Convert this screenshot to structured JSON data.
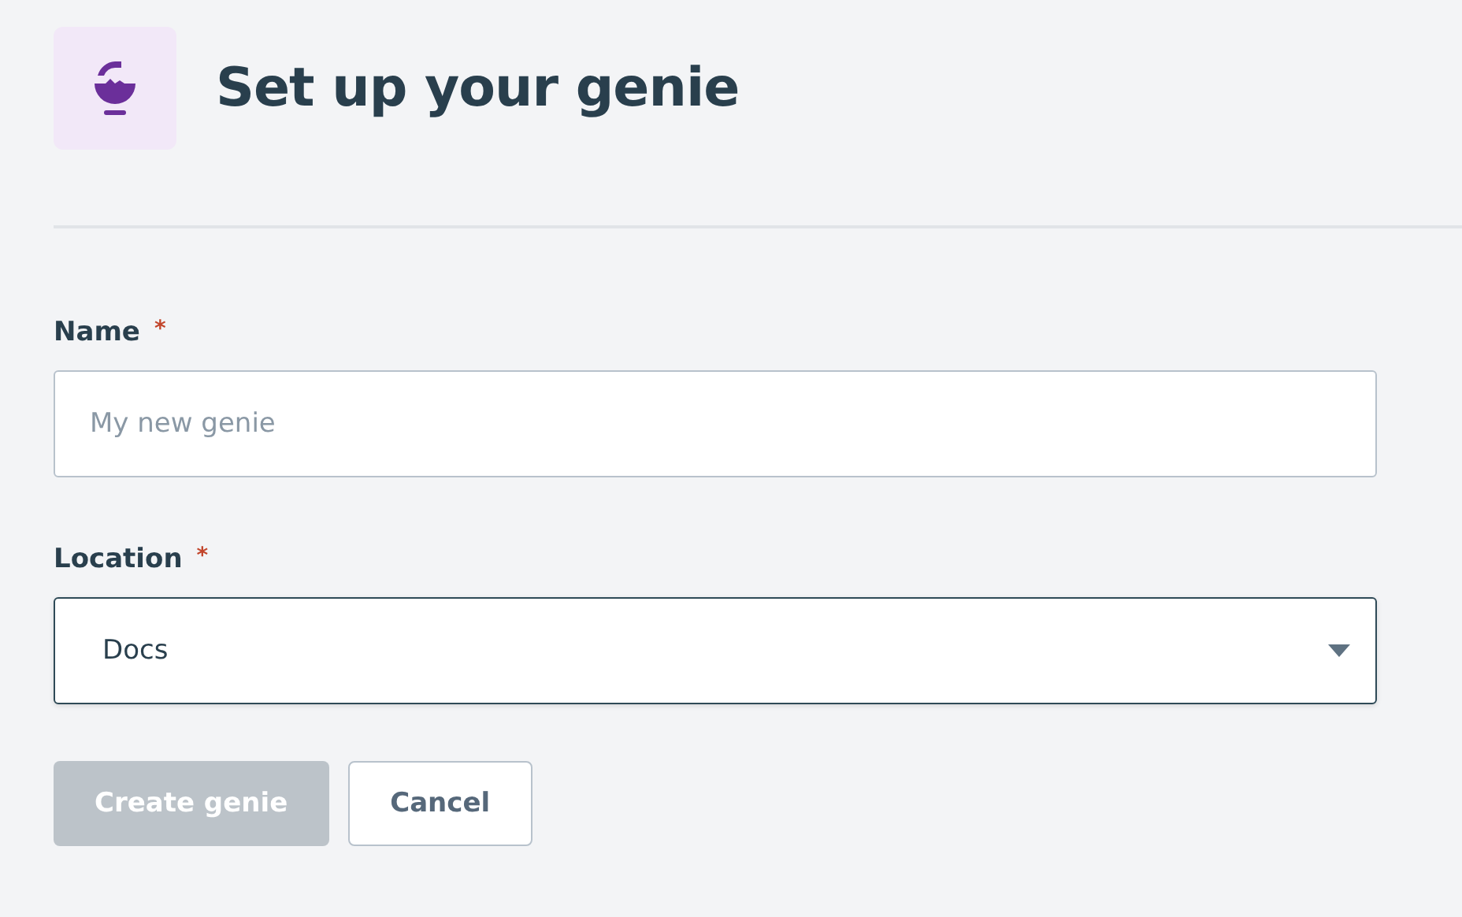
{
  "header": {
    "title": "Set up your genie"
  },
  "fields": [
    {
      "kind": "text",
      "label": "Name",
      "required_mark": "*",
      "placeholder": "My new genie",
      "focused": false
    },
    {
      "kind": "select",
      "label": "Location",
      "required_mark": "*",
      "value": "Docs",
      "focused": true
    }
  ],
  "buttons": [
    {
      "kind": "primary",
      "label": "Create genie",
      "disabled": true
    },
    {
      "kind": "secondary",
      "label": "Cancel",
      "disabled": false
    }
  ]
}
